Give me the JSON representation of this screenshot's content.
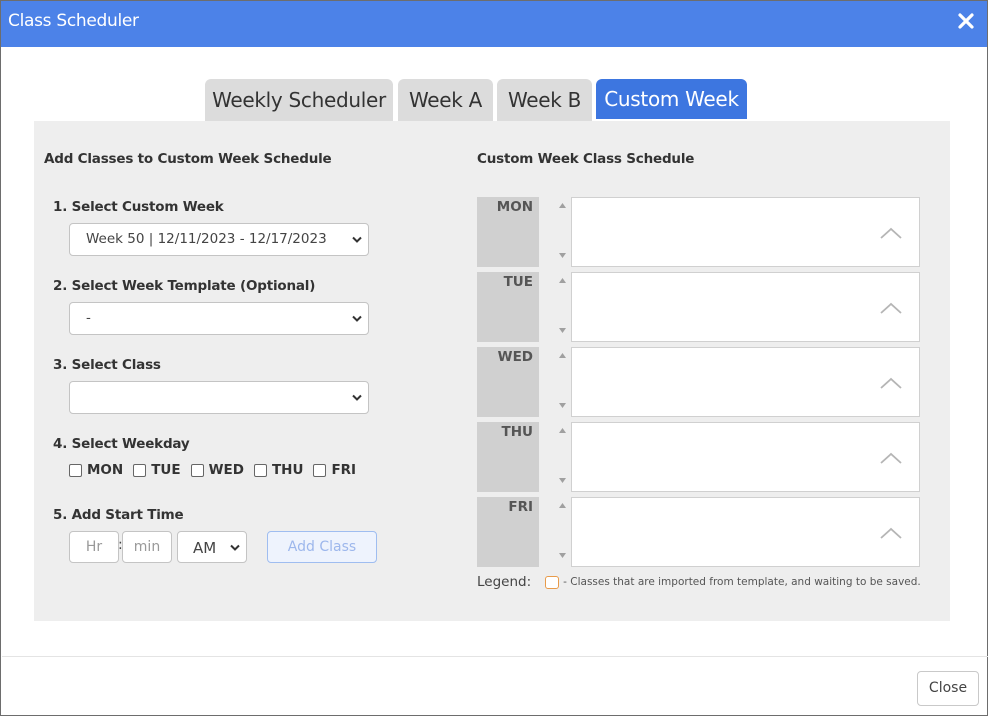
{
  "window": {
    "title": "Class Scheduler",
    "close_icon": "close-x-icon"
  },
  "tabs": [
    {
      "label": "Weekly Scheduler"
    },
    {
      "label": "Week A"
    },
    {
      "label": "Week B"
    },
    {
      "label": "Custom Week",
      "active": true
    }
  ],
  "left": {
    "heading": "Add Classes to Custom Week Schedule",
    "step1": {
      "label": "1. Select Custom Week",
      "value": "Week 50 | 12/11/2023 - 12/17/2023"
    },
    "step2": {
      "label": "2. Select Week Template (Optional)",
      "value": "-"
    },
    "step3": {
      "label": "3. Select Class",
      "value": ""
    },
    "step4": {
      "label": "4. Select Weekday",
      "days": [
        "MON",
        "TUE",
        "WED",
        "THU",
        "FRI"
      ]
    },
    "step5": {
      "label": "5. Add Start Time",
      "hour_placeholder": "Hr",
      "separator": ":",
      "min_placeholder": "min",
      "ampm": "AM",
      "add_button": "Add Class"
    }
  },
  "right": {
    "heading": "Custom Week Class Schedule",
    "days": [
      "MON",
      "TUE",
      "WED",
      "THU",
      "FRI"
    ],
    "legend_label": "Legend:",
    "legend_text": "- Classes that are imported from template, and waiting to be saved.",
    "legend_color": "#e89b4a"
  },
  "footer": {
    "close_button": "Close"
  },
  "colors": {
    "titlebar": "#4c82e8",
    "active_tab": "#3d76e0",
    "panel": "#eeeeee"
  }
}
